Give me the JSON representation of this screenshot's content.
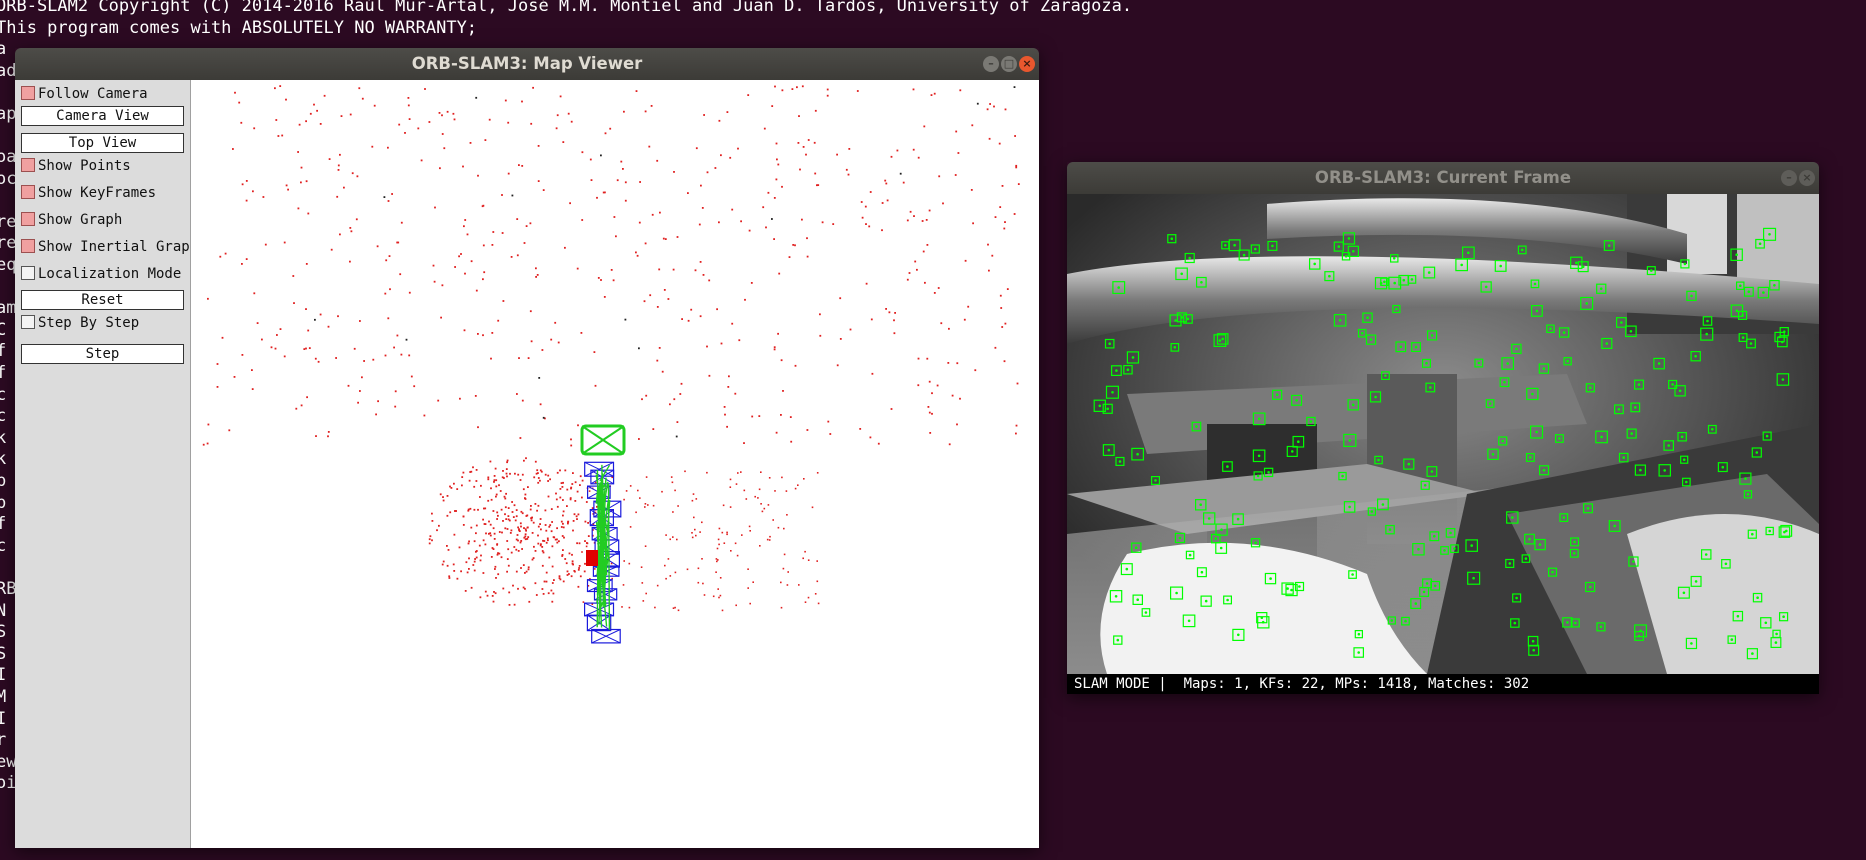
{
  "terminal": {
    "lines": [
      "ORB-SLAM2 Copyright (C) 2014-2016 Raúl Mur-Artal, José M.M. Montiel and Juan D. Tardós, University of Zaragoza.",
      "This program comes with ABSOLUTELY NO WARRANTY;"
    ],
    "fragments": [
      "a",
      "ad",
      "",
      "ap",
      "",
      "oa",
      "oc",
      "",
      "re",
      "re",
      "eq",
      "",
      "am",
      "C",
      "f",
      "f",
      "c",
      "c",
      "k",
      "k",
      "p",
      "p",
      "f",
      "c",
      "",
      "RB",
      "N",
      "S",
      "S",
      "I",
      "M",
      "I",
      "r",
      "ew",
      "oi"
    ]
  },
  "map_viewer": {
    "title": "ORB-SLAM3: Map Viewer",
    "controls": {
      "follow_camera": {
        "label": "Follow Camera",
        "checked": true
      },
      "camera_view": "Camera View",
      "top_view": "Top View",
      "show_points": {
        "label": "Show Points",
        "checked": true
      },
      "show_keyframes": {
        "label": "Show KeyFrames",
        "checked": true
      },
      "show_graph": {
        "label": "Show Graph",
        "checked": true
      },
      "show_inertial_graph": {
        "label": "Show Inertial Graph",
        "checked": true
      },
      "localization_mode": {
        "label": "Localization Mode",
        "checked": false
      },
      "reset": "Reset",
      "step_by_step": {
        "label": "Step By Step",
        "checked": false
      },
      "step": "Step"
    },
    "colors": {
      "map_points": "#e02020",
      "keyframes": "#1a1adc",
      "graph": "#22cc22",
      "current_camera": "#22cc22",
      "reference_points": "#e00000"
    }
  },
  "current_frame": {
    "title": "ORB-SLAM3: Current Frame",
    "status": "SLAM MODE |  Maps: 1, KFs: 22, MPs: 1418, Matches: 302",
    "feature_color": "#00ff00"
  },
  "window_buttons": {
    "minimize": "–",
    "maximize": "□",
    "close": "×"
  }
}
